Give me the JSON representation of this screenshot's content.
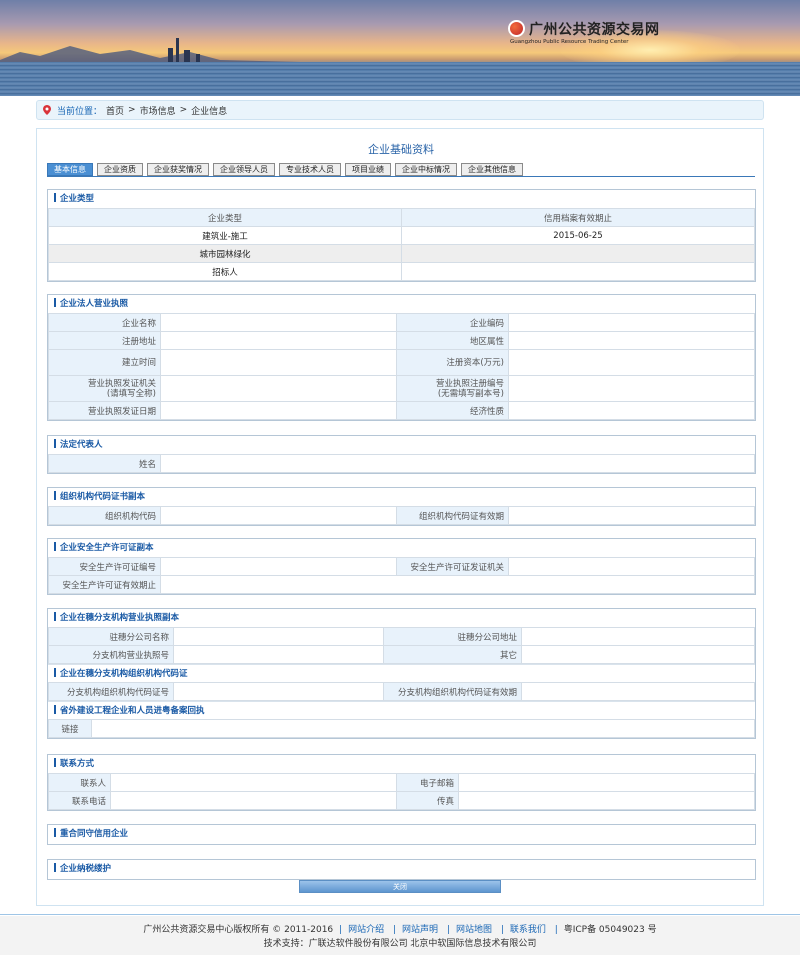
{
  "header": {
    "logo_name": "广州公共资源交易网",
    "logo_en": "Guangzhou Public Resource Trading Center"
  },
  "breadcrumb": {
    "label": "当前位置：",
    "items": [
      "首页",
      "市场信息",
      "企业信息"
    ],
    "separator": ">"
  },
  "page": {
    "title": "企业基础资料",
    "tabs": [
      "基本信息",
      "企业资质",
      "企业获奖情况",
      "企业领导人员",
      "专业技术人员",
      "项目业绩",
      "企业中标情况",
      "企业其他信息"
    ],
    "close_label": "关闭"
  },
  "sections": {
    "type": {
      "title": "企业类型",
      "col1": "企业类型",
      "col2": "信用档案有效期止",
      "rows": [
        {
          "type": "建筑业-施工",
          "expiry": "2015-06-25"
        },
        {
          "type": "城市园林绿化",
          "expiry": ""
        },
        {
          "type": "招标人",
          "expiry": ""
        }
      ]
    },
    "license": {
      "title": "企业法人营业执照",
      "f1": "企业名称",
      "f2": "企业编码",
      "f3": "注册地址",
      "f4": "地区属性",
      "f5": "建立时间",
      "f6": "注册资本(万元)",
      "f7a": "营业执照发证机关",
      "f7b": "(请填写全称)",
      "f8a": "营业执照注册编号",
      "f8b": "(无需填写副本号)",
      "f9": "营业执照发证日期",
      "f10": "经济性质"
    },
    "legal": {
      "title": "法定代表人",
      "f1": "姓名"
    },
    "org": {
      "title": "组织机构代码证书副本",
      "f1": "组织机构代码",
      "f2": "组织机构代码证有效期"
    },
    "safety": {
      "title": "企业安全生产许可证副本",
      "f1": "安全生产许可证编号",
      "f2": "安全生产许可证发证机关",
      "f3": "安全生产许可证有效期止"
    },
    "branch": {
      "title": "企业在穗分支机构营业执照副本",
      "f1": "驻穗分公司名称",
      "f2": "驻穗分公司地址",
      "f3": "分支机构营业执照号",
      "f4": "其它",
      "title2": "企业在穗分支机构组织机构代码证",
      "f5": "分支机构组织机构代码证号",
      "f6": "分支机构组织机构代码证有效期",
      "title3": "省外建设工程企业和人员进粤备案回执",
      "f7": "链接"
    },
    "contact": {
      "title": "联系方式",
      "f1": "联系人",
      "f2": "电子邮箱",
      "f3": "联系电话",
      "f4": "传真"
    },
    "credit": {
      "title": "重合同守信用企业"
    },
    "tax": {
      "title": "企业纳税缕护"
    }
  },
  "footer": {
    "copyright": "广州公共资源交易中心版权所有  © 2011-2016",
    "links": [
      "网站介绍",
      "网站声明",
      "网站地图",
      "联系我们"
    ],
    "icp": "粤ICP备 05049023 号",
    "support": "技术支持：广联达软件股份有限公司   北京中软国际信息技术有限公司"
  },
  "colors": {
    "accent": "#1a5aa5",
    "tab_active": "#4a8fd3",
    "header_cell": "#e8f2fb"
  }
}
